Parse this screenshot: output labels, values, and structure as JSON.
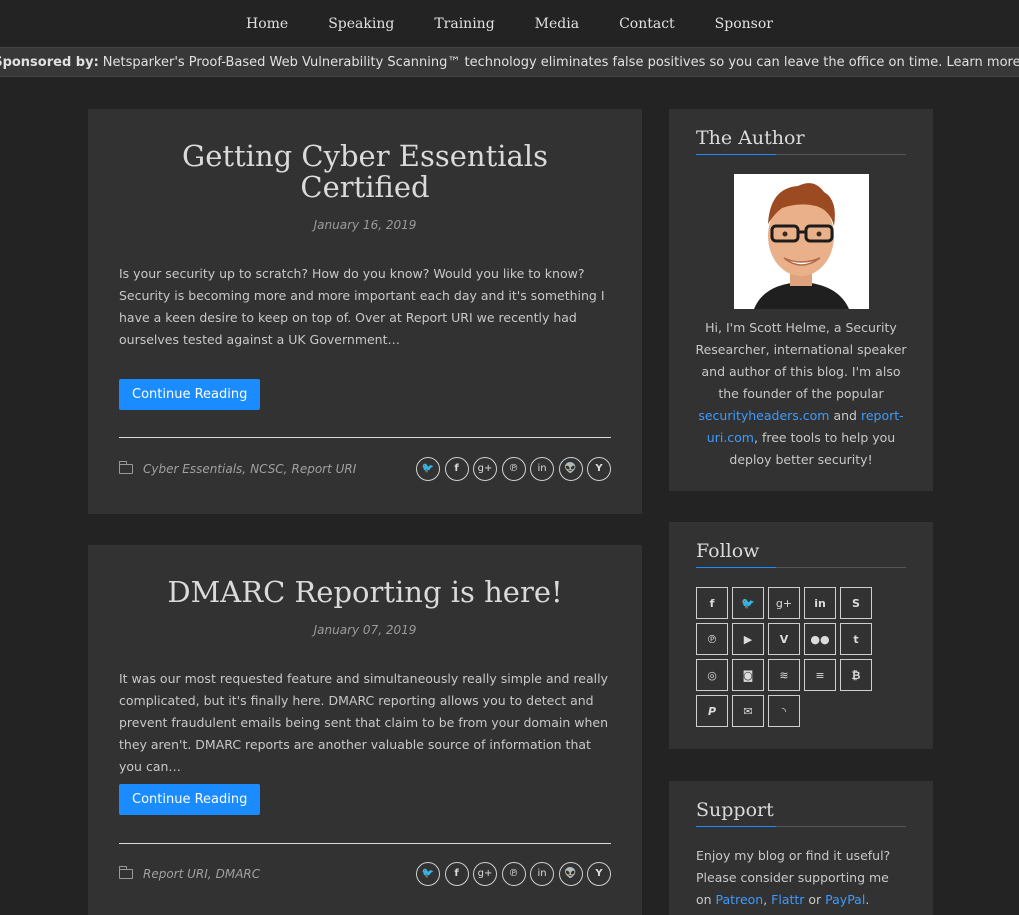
{
  "nav": {
    "items": [
      "Home",
      "Speaking",
      "Training",
      "Media",
      "Contact",
      "Sponsor"
    ]
  },
  "sponsor": {
    "label": "Sponsored by:",
    "text": "Netsparker's Proof-Based Web Vulnerability Scanning™ technology eliminates false positives so you can leave the office on time. Learn more!"
  },
  "posts": [
    {
      "title_line1": "Getting Cyber Essentials",
      "title_line2": "Certified",
      "date": "January 16, 2019",
      "excerpt": "Is your security up to scratch? How do you know? Would you like to know? Security is becoming more and more important each day and it's something I have a keen desire to keep on top of. Over at Report URI we recently had ourselves tested against a UK Government…",
      "button": "Continue Reading",
      "tags": [
        "Cyber Essentials,",
        "NCSC,",
        "Report URI"
      ]
    },
    {
      "title": "DMARC Reporting is here!",
      "date": "January 07, 2019",
      "excerpt": "It was our most requested feature and simultaneously really simple and really complicated, but it's finally here. DMARC reporting allows you to detect and prevent fraudulent emails being sent that claim to be from your domain when they aren't. DMARC reports are another valuable source of information that you can…",
      "button": "Continue Reading",
      "tags": [
        "Report URI,",
        "DMARC"
      ]
    }
  ],
  "share_icons": {
    "twitter": "twitter-icon",
    "facebook": "facebook-icon",
    "googleplus": "google-plus-icon",
    "pinterest": "pinterest-icon",
    "linkedin": "linkedin-icon",
    "reddit": "reddit-icon",
    "ycombinator": "hacker-news-icon"
  },
  "author": {
    "heading": "The Author",
    "text_before": "Hi, I'm Scott Helme, a Security Researcher, international speaker and author of this blog. I'm also the founder of the popular ",
    "link1": "securityheaders.com",
    "text_mid": " and ",
    "link2": "report-uri.com",
    "text_after": ", free tools to help you deploy better security!"
  },
  "follow": {
    "heading": "Follow",
    "icons": [
      "facebook-icon",
      "twitter-icon",
      "google-plus-icon",
      "linkedin-icon",
      "skype-icon",
      "pinterest-icon",
      "youtube-icon",
      "vimeo-icon",
      "flickr-icon",
      "tumblr-icon",
      "github-icon",
      "instagram-icon",
      "stackoverflow-icon",
      "stack-exchange-icon",
      "bitcoin-icon",
      "paypal-icon",
      "email-icon",
      "rss-icon"
    ]
  },
  "support": {
    "heading": "Support",
    "text_before": "Enjoy my blog or find it useful? Please consider supporting me on ",
    "link1": "Patreon",
    "sep": ", ",
    "link2": "Flattr",
    "text_mid": " or ",
    "link3": "PayPal",
    "text_after": "."
  },
  "colors": {
    "page_bg": "#232323",
    "card_bg": "#323232",
    "accent": "#1a8cff",
    "link": "#3d9bff"
  }
}
